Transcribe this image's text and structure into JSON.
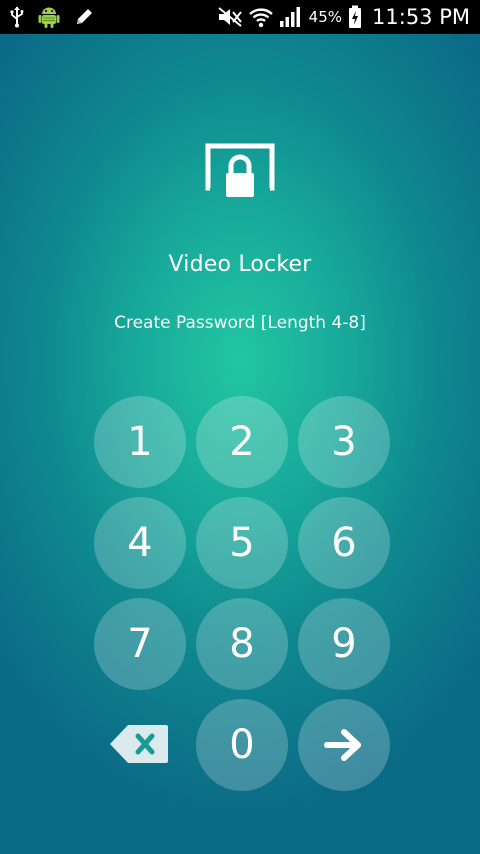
{
  "status_bar": {
    "battery_percent": "45%",
    "time": "11:53 PM",
    "icons": [
      "usb-icon",
      "android-debug-icon",
      "edit-icon",
      "mute-icon",
      "wifi-icon",
      "signal-icon",
      "battery-charging-icon"
    ]
  },
  "app": {
    "title": "Video Locker",
    "subtitle": "Create Password [Length 4-8]",
    "icon": "screen-lock-icon"
  },
  "keypad": {
    "keys": [
      "1",
      "2",
      "3",
      "4",
      "5",
      "6",
      "7",
      "8",
      "9",
      "0"
    ],
    "backspace_icon": "backspace-icon",
    "submit_icon": "arrow-right-icon"
  },
  "colors": {
    "background_center": "#22c6a2",
    "background_edge": "#0b6a86",
    "status_bar": "#000000",
    "text": "#ffffff"
  }
}
